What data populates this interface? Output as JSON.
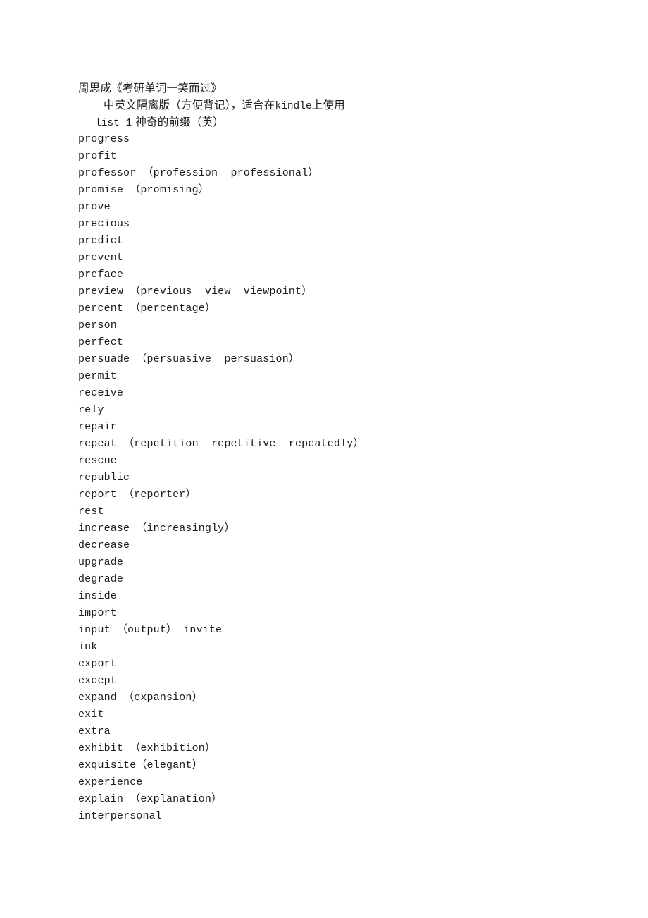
{
  "document": {
    "background_color": "#ffffff",
    "text_color": "#1a1a1a",
    "header": {
      "line1": "周思成《考研单词一笑而过》",
      "line2_prefix": "中英文隔离版（方便背记），适合在",
      "line2_latin": "kindle",
      "line2_suffix": "上使用",
      "line3_latin": "list 1",
      "line3_suffix": " 神奇的前缀（英）"
    },
    "words": [
      "progress",
      "profit",
      "professor （profession  professional）",
      "promise （promising）",
      "prove",
      "precious",
      "predict",
      "prevent",
      "preface",
      "preview （previous  view  viewpoint）",
      "percent （percentage）",
      "person",
      "perfect",
      "persuade （persuasive  persuasion）",
      "permit",
      "receive",
      "rely",
      "repair",
      "repeat （repetition  repetitive  repeatedly）",
      "rescue",
      "republic",
      "report （reporter）",
      "rest",
      "increase （increasingly）",
      "decrease",
      "upgrade",
      "degrade",
      "inside",
      "import",
      "input （output） invite",
      "ink",
      "export",
      "except",
      "expand （expansion）",
      "exit",
      "extra",
      "exhibit （exhibition）",
      "exquisite（elegant）",
      "experience",
      "explain （explanation）",
      "interpersonal"
    ]
  }
}
